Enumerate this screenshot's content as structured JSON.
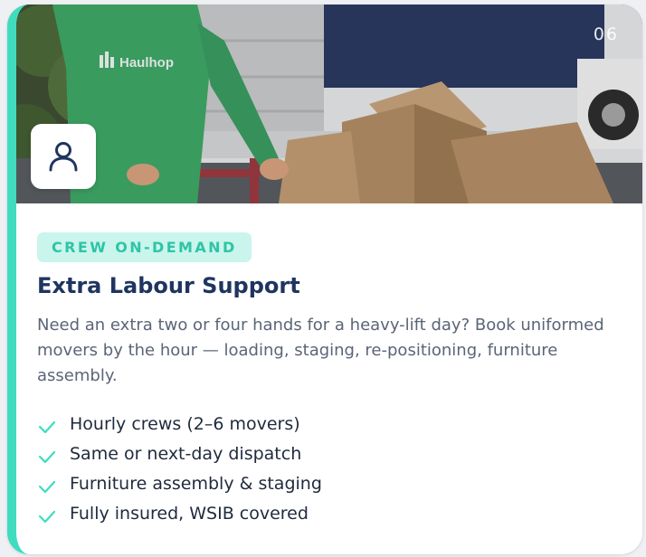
{
  "card": {
    "number": "06",
    "badge": "CREW ON-DEMAND",
    "title": "Extra Labour Support",
    "description": "Need an extra two or four hands for a heavy-lift day? Book uniformed movers by the hour — loading, staging, re-positioning, furniture assembly.",
    "features": [
      "Hourly crews (2–6 movers)",
      "Same or next-day dispatch",
      "Furniture assembly & staging",
      "Fully insured, WSIB covered"
    ],
    "photo": {
      "shirt_logo": "Haulhop"
    },
    "icons": {
      "avatar": "user-icon",
      "check": "check-icon"
    },
    "colors": {
      "accent": "#3fdcc0",
      "badge_bg": "#c9f5ec",
      "badge_text": "#2fc4a6",
      "title": "#1f3560"
    }
  }
}
